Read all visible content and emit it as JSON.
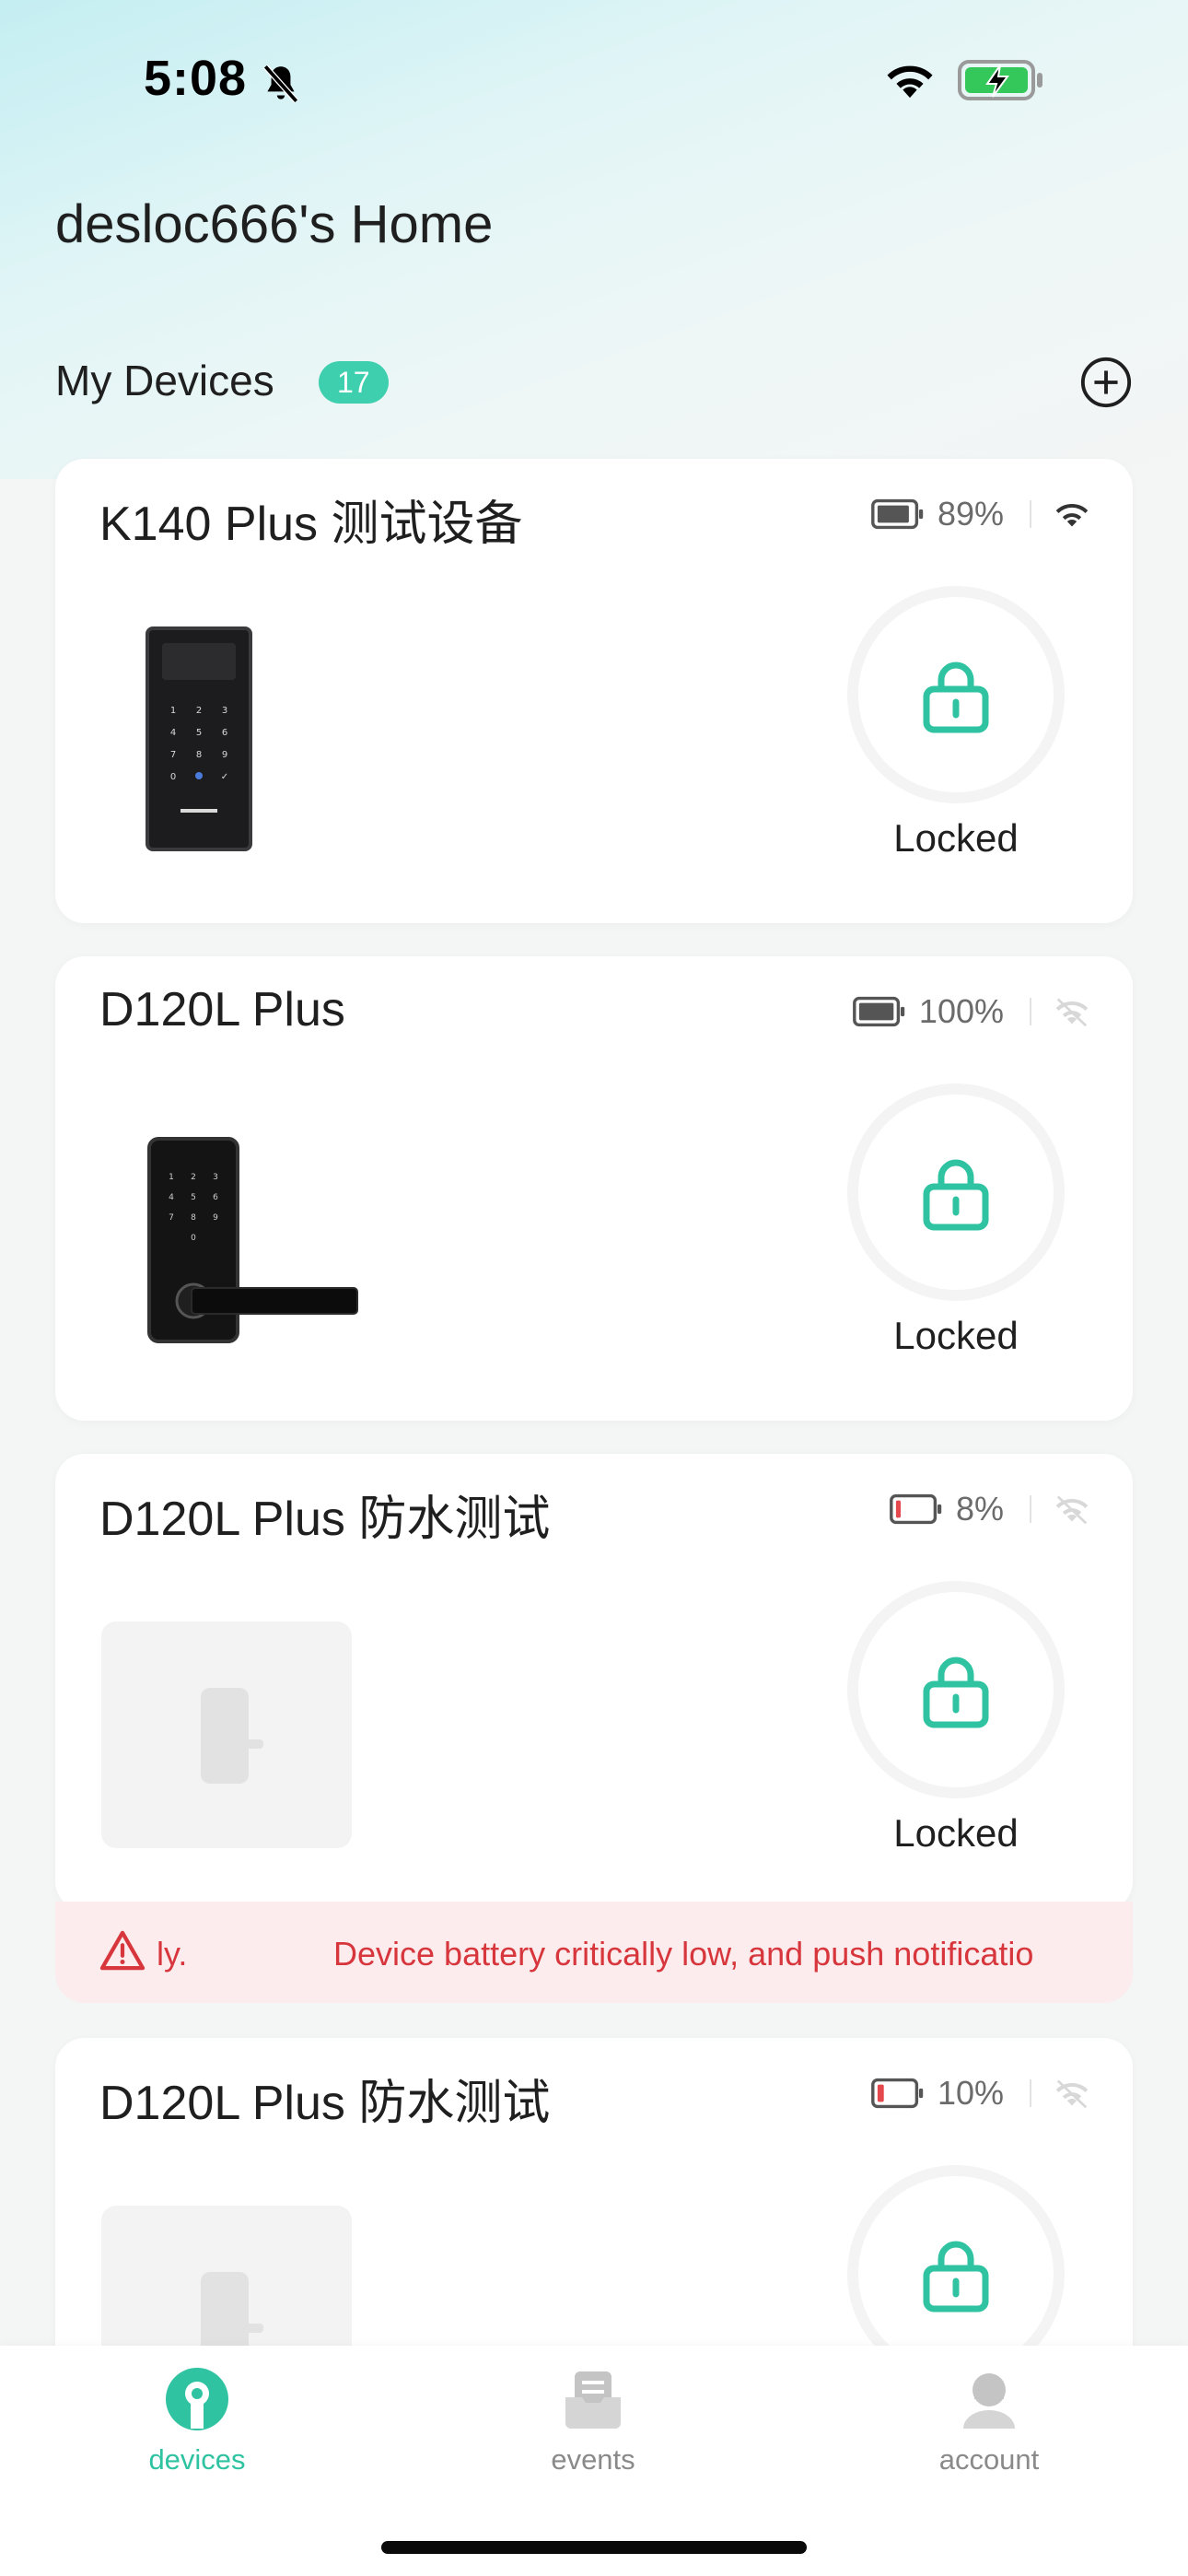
{
  "status_bar": {
    "time": "5:08",
    "icons": [
      "bell-slash-icon",
      "wifi-icon",
      "battery-charging-icon"
    ]
  },
  "home": {
    "title": "desloc666's Home"
  },
  "section": {
    "title": "My Devices",
    "count": "17",
    "add_icon": "plus-circle-icon"
  },
  "devices": [
    {
      "name": "K140 Plus 测试设备",
      "battery": "89%",
      "battery_level": 0.89,
      "battery_color": "#555555",
      "wifi": "connected",
      "lock_state": "Locked"
    },
    {
      "name": "D120L Plus",
      "battery": "100%",
      "battery_level": 1.0,
      "battery_color": "#555555",
      "wifi": "disconnected",
      "lock_state": "Locked"
    },
    {
      "name": "D120L Plus 防水测试",
      "battery": "8%",
      "battery_level": 0.08,
      "battery_color": "#e5484d",
      "wifi": "disconnected",
      "lock_state": "Locked",
      "alert": {
        "fragment": "ly.",
        "message": "Device battery critically low, and push notificatio"
      }
    },
    {
      "name": "D120L Plus 防水测试",
      "battery": "10%",
      "battery_level": 0.1,
      "battery_color": "#e5484d",
      "wifi": "disconnected",
      "lock_state": ""
    }
  ],
  "colors": {
    "accent": "#2fc3a2",
    "badge": "#3dcfae",
    "alert_text": "#d6363c",
    "alert_bg": "#fdeced"
  },
  "tabs": [
    {
      "label": "devices",
      "icon": "devices-icon",
      "active": true
    },
    {
      "label": "events",
      "icon": "events-icon",
      "active": false
    },
    {
      "label": "account",
      "icon": "account-icon",
      "active": false
    }
  ]
}
